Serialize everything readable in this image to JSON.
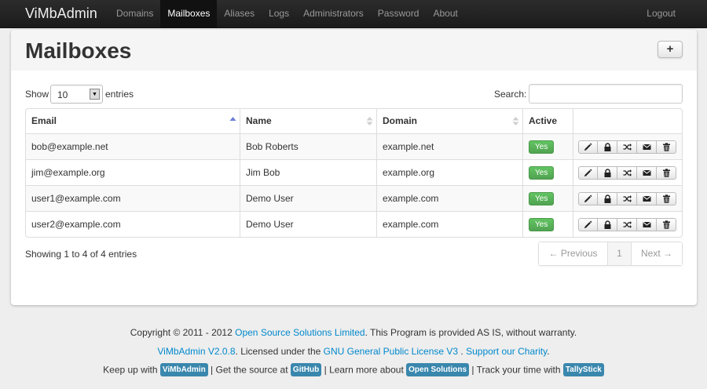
{
  "app": {
    "brand": "ViMbAdmin",
    "nav": [
      "Domains",
      "Mailboxes",
      "Aliases",
      "Logs",
      "Administrators",
      "Password",
      "About"
    ],
    "active_nav": "Mailboxes",
    "logout": "Logout"
  },
  "page": {
    "title": "Mailboxes",
    "add_button": "+"
  },
  "controls": {
    "show_label": "Show",
    "entries_label": "entries",
    "page_length": "10",
    "search_label": "Search:",
    "search_value": ""
  },
  "table": {
    "headers": {
      "email": "Email",
      "name": "Name",
      "domain": "Domain",
      "active": "Active"
    },
    "rows": [
      {
        "email": "bob@example.net",
        "name": "Bob Roberts",
        "domain": "example.net",
        "active": "Yes"
      },
      {
        "email": "jim@example.org",
        "name": "Jim Bob",
        "domain": "example.org",
        "active": "Yes"
      },
      {
        "email": "user1@example.com",
        "name": "Demo User",
        "domain": "example.com",
        "active": "Yes"
      },
      {
        "email": "user2@example.com",
        "name": "Demo User",
        "domain": "example.com",
        "active": "Yes"
      }
    ],
    "row_actions": [
      "pencil-icon",
      "lock-icon",
      "shuffle-icon",
      "envelope-icon",
      "trash-icon"
    ]
  },
  "pagination": {
    "info": "Showing 1 to 4 of 4 entries",
    "previous": "← Previous",
    "page": "1",
    "next": "Next →"
  },
  "footer": {
    "copyright_prefix": "Copyright © 2011 - 2012",
    "copyright_link": "Open Source Solutions Limited",
    "copyright_suffix": ". This Program is provided AS IS, without warranty.",
    "version_link": "ViMbAdmin V2.0.8",
    "license_prefix": ". Licensed under the",
    "license_link": "GNU General Public License V3",
    "license_sep": ".",
    "charity_link": "Support our Charity",
    "charity_suffix": ".",
    "keep_up": "Keep up with",
    "keep_up_tag": "ViMbAdmin",
    "source": "Get the source at",
    "source_tag": "GitHub",
    "learn": "Learn more about",
    "learn_tag": "Open Solutions",
    "track": "Track your time with",
    "track_tag": "TallyStick",
    "separator": "|"
  },
  "colors": {
    "navbar": "#1b1b1b",
    "link": "#0088cc",
    "active_badge": "#5bb75b",
    "info_tag": "#3a87ad"
  }
}
